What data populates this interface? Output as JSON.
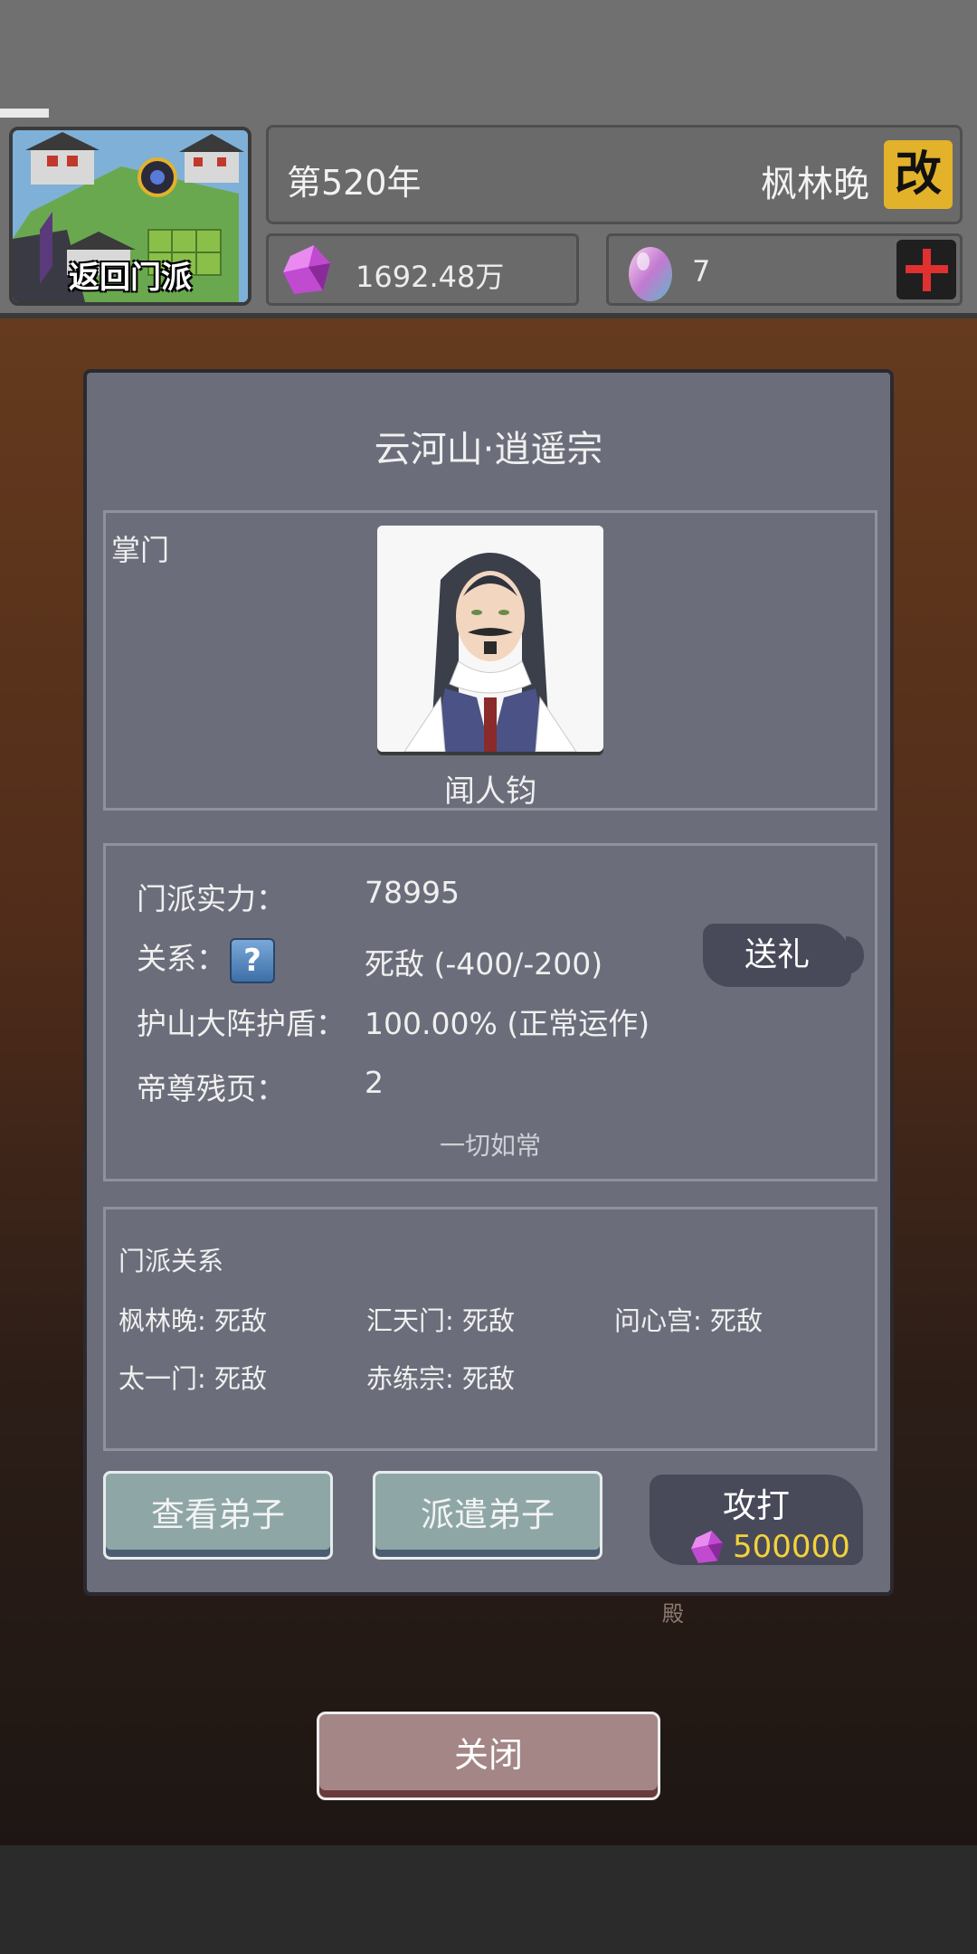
{
  "header": {
    "back_label": "返回门派",
    "year": "第520年",
    "sect_name": "枫林晚",
    "rename_icon": "改",
    "spirit_stones": "1692.48万",
    "eggs": "7"
  },
  "dialog": {
    "title": "云河山·逍遥宗",
    "leader_label": "掌门",
    "leader_name": "闻人钧",
    "stats": {
      "power_label": "门派实力：",
      "power_value": "78995",
      "relation_label": "关系：",
      "relation_value": "死敌 (-400/-200)",
      "shield_label": "护山大阵护盾：",
      "shield_value": "100.00% (正常运作)",
      "pages_label": "帝尊残页：",
      "pages_value": "2",
      "status_note": "一切如常",
      "gift_label": "送礼"
    },
    "relations": {
      "heading": "门派关系",
      "items": [
        "枫林晚: 死敌",
        "汇天门: 死敌",
        "问心宫: 死敌",
        "太一门: 死敌",
        "赤练宗: 死敌"
      ]
    },
    "buttons": {
      "view_disciples": "查看弟子",
      "dispatch_disciples": "派遣弟子",
      "attack": "攻打",
      "attack_cost": "500000"
    }
  },
  "close_label": "关闭",
  "background_text": "殿",
  "colors": {
    "dialog_bg": "#6b6e7a",
    "teal_button": "#8ea7a6",
    "close_button": "#a48686",
    "cost_gold": "#f4d23a",
    "rename_yellow": "#e3b22b",
    "plus_red": "#e03030"
  },
  "icons": [
    "spirit-stone-icon",
    "spirit-egg-icon",
    "plus-icon",
    "help-icon",
    "rename-icon"
  ]
}
